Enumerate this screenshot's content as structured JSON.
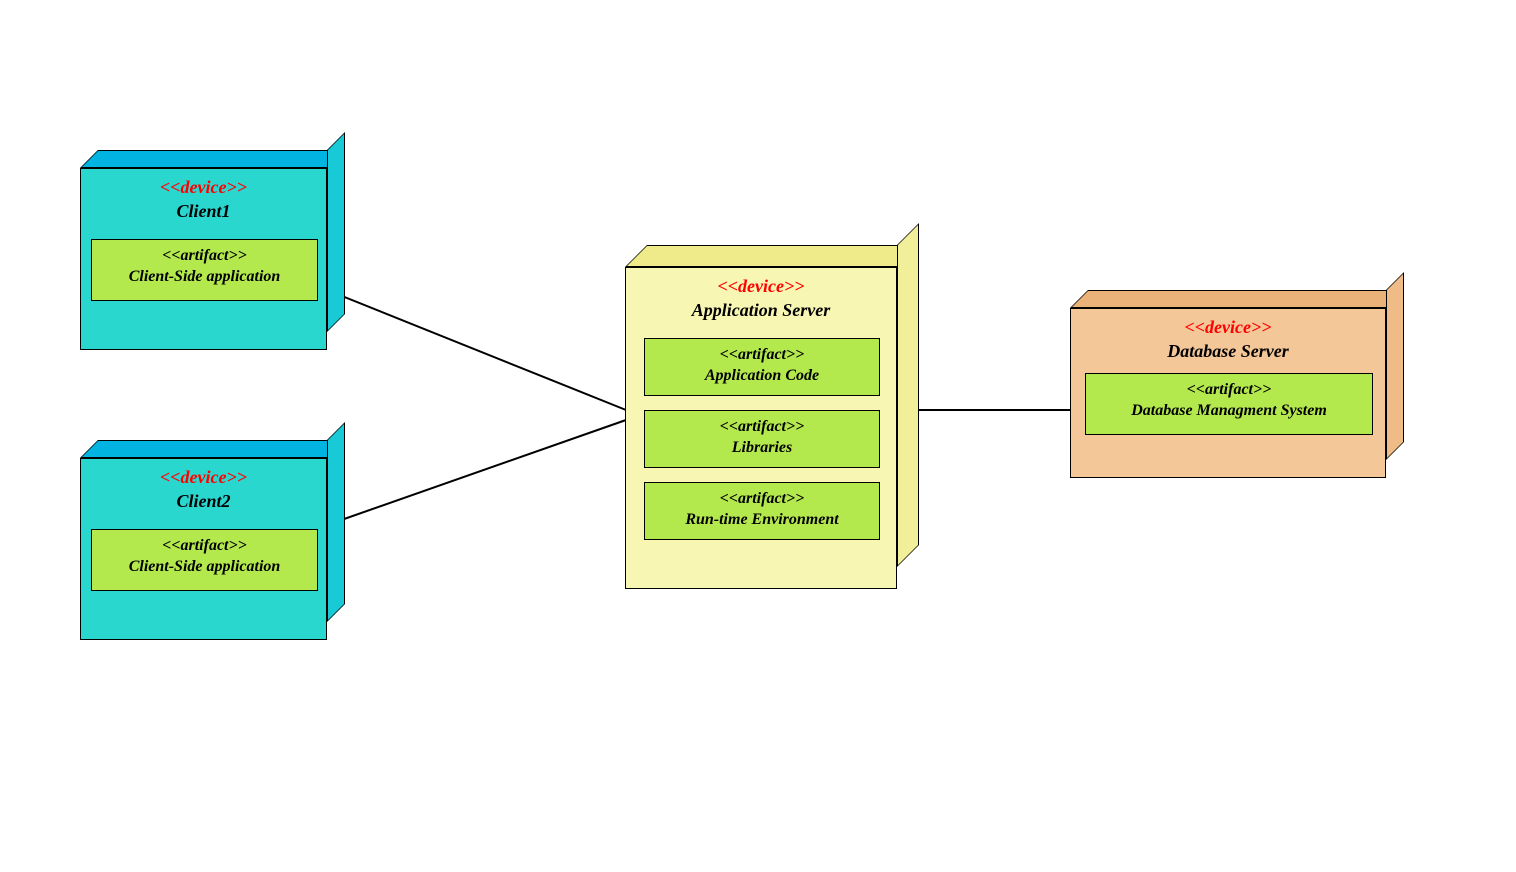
{
  "diagram": {
    "nodes": {
      "client1": {
        "stereotype": "<<device>>",
        "name": "Client1",
        "artifacts": [
          {
            "stereotype": "<<artifact>>",
            "name": "Client-Side application"
          }
        ],
        "color": "#2ad7cf"
      },
      "client2": {
        "stereotype": "<<device>>",
        "name": "Client2",
        "artifacts": [
          {
            "stereotype": "<<artifact>>",
            "name": "Client-Side application"
          }
        ],
        "color": "#2ad7cf"
      },
      "appserver": {
        "stereotype": "<<device>>",
        "name": "Application Server",
        "artifacts": [
          {
            "stereotype": "<<artifact>>",
            "name": "Application Code"
          },
          {
            "stereotype": "<<artifact>>",
            "name": "Libraries"
          },
          {
            "stereotype": "<<artifact>>",
            "name": "Run-time Environment"
          }
        ],
        "color": "#f8f6b3"
      },
      "dbserver": {
        "stereotype": "<<device>>",
        "name": "Database Server",
        "artifacts": [
          {
            "stereotype": "<<artifact>>",
            "name": "Database Managment System"
          }
        ],
        "color": "#f4c799"
      }
    },
    "edges": [
      {
        "from": "client1",
        "to": "appserver"
      },
      {
        "from": "client2",
        "to": "appserver"
      },
      {
        "from": "appserver",
        "to": "dbserver"
      }
    ],
    "colors": {
      "artifact": "#b4e94e",
      "stereotypeText": "#ff0000",
      "edge": "#000000"
    }
  }
}
